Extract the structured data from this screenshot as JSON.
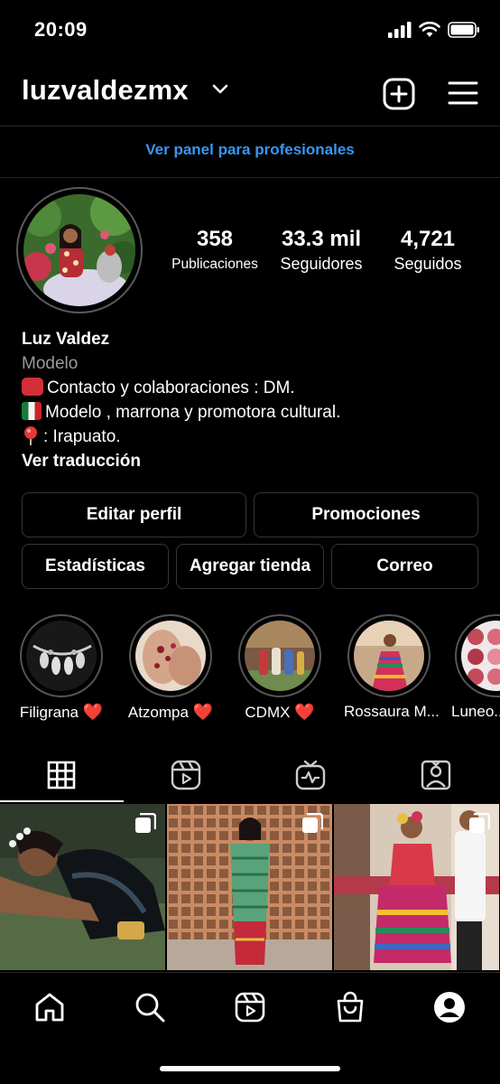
{
  "status_bar": {
    "time": "20:09"
  },
  "header": {
    "username": "luzvaldezmx"
  },
  "pro_panel": {
    "label": "Ver panel para profesionales"
  },
  "stats": {
    "posts": {
      "count": "358",
      "label": "Publicaciones"
    },
    "followers": {
      "count": "33.3 mil",
      "label": "Seguidores"
    },
    "following": {
      "count": "4,721",
      "label": "Seguidos"
    }
  },
  "bio": {
    "name": "Luz Valdez",
    "category": "Modelo",
    "lines": [
      "Contacto y colaboraciones : DM.",
      "Modelo , marrona y promotora cultural.",
      ": Irapuato."
    ],
    "translate": "Ver traducción"
  },
  "buttons": {
    "edit_profile": "Editar perfil",
    "promotions": "Promociones",
    "insights": "Estadísticas",
    "add_shop": "Agregar tienda",
    "email": "Correo"
  },
  "highlights": [
    {
      "label": "Filigrana",
      "heart": "❤️"
    },
    {
      "label": "Atzompa",
      "heart": "❤️"
    },
    {
      "label": "CDMX",
      "heart": "❤️"
    },
    {
      "label": "Rossaura M...",
      "heart": ""
    },
    {
      "label": "Luneo...",
      "heart": ""
    }
  ],
  "icons": {
    "wifi": "wifi-icon",
    "battery": "battery-icon",
    "signal": "signal-icon",
    "grid": "grid-icon",
    "reels": "reels-icon",
    "igtv": "igtv-icon",
    "tagged": "tagged-icon",
    "home": "home-icon",
    "search": "search-icon",
    "shop": "shop-icon",
    "profile": "profile-icon"
  },
  "colors": {
    "link": "#3897f0",
    "heart": "#e0245e"
  }
}
